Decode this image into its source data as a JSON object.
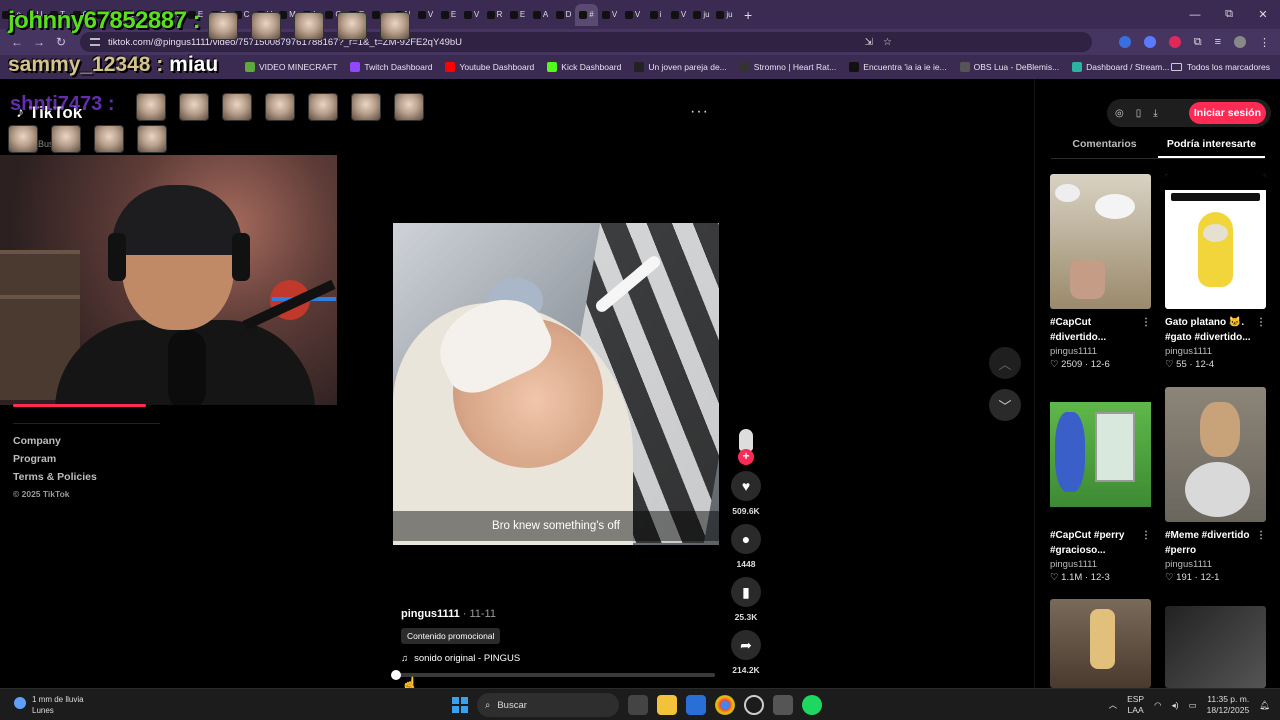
{
  "browser": {
    "url": "tiktok.com/@pingus1111/video/7571500879761788167?_r=1&_t=ZM-92FE2qY49bU",
    "tab_labels": [
      "Lo",
      "U",
      "T",
      "C",
      "V",
      "G",
      "R",
      "V",
      "E",
      "T",
      "C",
      "V",
      "M",
      "L",
      "G",
      "E",
      "¿",
      "N",
      "V",
      "E",
      "V",
      "R",
      "E",
      "A",
      "D",
      "#",
      "V",
      "V",
      "i",
      "V",
      "ju",
      "ju"
    ],
    "active_tab_label": "V",
    "new_tab_symbol": "+",
    "window_controls": [
      "—",
      "⧉",
      "✕"
    ]
  },
  "bookmarks": {
    "items": [
      {
        "label": "VIDEO MINECRAFT",
        "color": "#5fa83a"
      },
      {
        "label": "Twitch Dashboard",
        "color": "#9146ff"
      },
      {
        "label": "Youtube Dashboard",
        "color": "#ff0000"
      },
      {
        "label": "Kick Dashboard",
        "color": "#53fc18"
      },
      {
        "label": "Un joven pareja de...",
        "color": "#222222"
      },
      {
        "label": "Stromno | Heart Rat...",
        "color": "#333333"
      },
      {
        "label": "Encuentra 'ia ia ie ie...",
        "color": "#111111"
      },
      {
        "label": "OBS Lua - DeBlemis...",
        "color": "#555555"
      },
      {
        "label": "Dashboard / Stream...",
        "color": "#2bb3a0"
      }
    ],
    "all_bookmarks": "Todos los marcadores"
  },
  "overlay_chat": {
    "line1_user": "johnny67852887 :",
    "line2_user": "sammy_12348 :",
    "line2_msg": "miau",
    "line3_user": "shnti7473 :"
  },
  "tiktok": {
    "logo": "TikTok",
    "search_stub": "Busc",
    "menu": "···",
    "footer_links": [
      "Company",
      "Program",
      "Terms & Policies"
    ],
    "copyright": "© 2025 TikTok",
    "caption": "Bro knew something's off",
    "author": "pingus1111",
    "date": " · 11-11",
    "promo": "Contenido promocional",
    "sound": "sonido original - PINGUS",
    "progress": 0.01,
    "actions": {
      "likes": "509.6K",
      "comments": "1448",
      "saves": "25.3K",
      "shares": "214.2K"
    },
    "login": "Iniciar sesión",
    "tabs": [
      "Comentarios",
      "Podría interesarte"
    ],
    "active_tab": "Podría interesarte",
    "recommended": [
      {
        "title1": "#CapCut",
        "title2": "#divertido...",
        "author": "pingus1111",
        "stats": "♡ 2509 · 12-6"
      },
      {
        "title1": "Gato platano 🐱.",
        "title2": "#gato #divertido...",
        "author": "pingus1111",
        "stats": "♡ 55 · 12-4"
      },
      {
        "title1": "#CapCut #perry",
        "title2": "#gracioso...",
        "author": "pingus1111",
        "stats": "♡ 1.1M · 12-3"
      },
      {
        "title1": "#Meme #divertido",
        "title2": "#perro",
        "author": "pingus1111",
        "stats": "♡ 191 · 12-1"
      }
    ]
  },
  "taskbar": {
    "weather_line1": "1 mm de lluvia",
    "weather_line2": "Lunes",
    "search": "Buscar",
    "lang1": "ESP",
    "lang2": "LAA",
    "time": "11:35 p. m.",
    "date": "18/12/2025"
  }
}
